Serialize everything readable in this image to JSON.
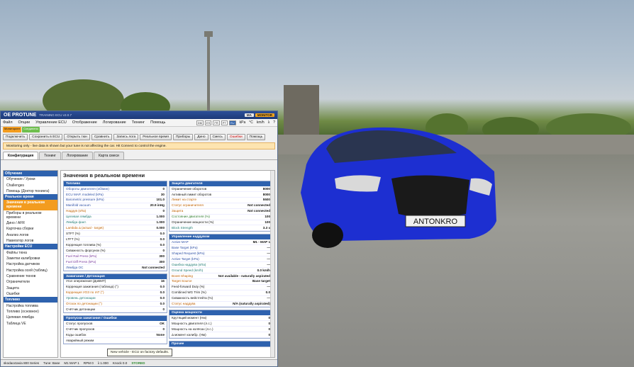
{
  "app": {
    "title": "OE PROTUNE",
    "subtitle": "TRAINING ECU  v3.0.7",
    "badge_ma": "MA",
    "badge_monitor": "MONITOR"
  },
  "menu": [
    "Файл",
    "Опции",
    "Управление ECU",
    "Отображение",
    "Логирование",
    "Тюнинг",
    "Помощь"
  ],
  "units": {
    "boxes": [
      "DM",
      "ES",
      "FR",
      "PT",
      "RU"
    ],
    "labels": [
      "kPa",
      "°C",
      "km/h",
      "λ",
      "?"
    ]
  },
  "modes": {
    "first": "Мониторинг",
    "second": "Соединено"
  },
  "toolbar": [
    "Подключить",
    "Сохранить в ECU",
    "Открыть тюн",
    "Сравнить",
    "Запись лога",
    "Реальное время",
    "Приборы",
    "Дино",
    "Смесь",
    "Ошибки",
    "Помощь"
  ],
  "warning": "Monitoring only - live data is shown but your tune is not affecting the car. Hit Connect to control the engine.",
  "tabs": [
    "Конфигурация",
    "Тюнинг",
    "Логирование",
    "Карта смеси"
  ],
  "sidebar": [
    {
      "type": "head",
      "text": "Обучение"
    },
    {
      "type": "item",
      "text": "Обучение / Уроки"
    },
    {
      "type": "item",
      "text": "Challenges"
    },
    {
      "type": "item",
      "text": "Помощь (Доктор тюнинга)"
    },
    {
      "type": "head",
      "text": "Реальное время"
    },
    {
      "type": "item",
      "text": "Значения в реальном времени",
      "active": true
    },
    {
      "type": "item",
      "text": "Приборы в реальном времени"
    },
    {
      "type": "item",
      "text": "Дино / AFR"
    },
    {
      "type": "item",
      "text": "Карточка сборки"
    },
    {
      "type": "item",
      "text": "Анализ логов"
    },
    {
      "type": "item",
      "text": "Навигатор логов"
    },
    {
      "type": "head",
      "text": "Настройки ECU"
    },
    {
      "type": "item",
      "text": "Файлы тюна"
    },
    {
      "type": "item",
      "text": "Заметки калибровки"
    },
    {
      "type": "item",
      "text": "Настройка датчиков"
    },
    {
      "type": "item",
      "text": "Настройка осей (таблиц)"
    },
    {
      "type": "item",
      "text": "Сравнение тюнов"
    },
    {
      "type": "item",
      "text": "Ограничители"
    },
    {
      "type": "item",
      "text": "Защита"
    },
    {
      "type": "item",
      "text": "Ошибки"
    },
    {
      "type": "head",
      "text": "Топливо"
    },
    {
      "type": "item",
      "text": "Настройка топлива"
    },
    {
      "type": "item",
      "text": "Топливо (основное)"
    },
    {
      "type": "item",
      "text": "Целевая лямбда"
    },
    {
      "type": "item",
      "text": "Таблица VE"
    }
  ],
  "main_title": "Значения в реальном времени",
  "left_panels": [
    {
      "title": "Топливо",
      "rows": [
        {
          "l": "Обороты двигателя (об/мин)",
          "v": "0",
          "c": "blue"
        },
        {
          "l": "ECU MAP, modeled (kPa)",
          "v": "30",
          "c": "blue"
        },
        {
          "l": "Barometric pressure (kPa)",
          "v": "101.0",
          "c": "blue"
        },
        {
          "l": "Manifold vacuum",
          "v": "20.9 inHg",
          "c": "blue"
        },
        {
          "l": "Наддув (кПа)",
          "v": "0",
          "c": "orange"
        },
        {
          "l": "Целевая лямбда",
          "v": "1.000",
          "c": "teal"
        },
        {
          "l": "Лямбда факт.",
          "v": "1.000",
          "c": "teal"
        },
        {
          "l": "Lambda Δ (actual - target)",
          "v": "0.000",
          "c": "orange"
        },
        {
          "l": "STFT (%)",
          "v": "0.0",
          "c": ""
        },
        {
          "l": "LTFT (%)",
          "v": "0.0",
          "c": ""
        },
        {
          "l": "Коррекция топлива (%)",
          "v": "0.0",
          "c": ""
        },
        {
          "l": "Скважность форсунок (%)",
          "v": "0",
          "c": ""
        },
        {
          "l": "Fuel Rail Press (kPa)",
          "v": "300",
          "c": "purple"
        },
        {
          "l": "Fuel Diff Press (kPa)",
          "v": "300",
          "c": "purple"
        },
        {
          "l": "Лямбда ОС",
          "v": "Not connected",
          "c": "blue"
        }
      ]
    },
    {
      "title": "Зажигание / Детонация",
      "rows": [
        {
          "l": "Угол опережения (ДоВМТ)",
          "v": "16",
          "c": ""
        },
        {
          "l": "Коррекция зажигания (таблица) (°)",
          "v": "0.0",
          "c": ""
        },
        {
          "l": "Коррекция УОЗ по IAT (°)",
          "v": "0.0",
          "c": "orange"
        },
        {
          "l": "Уровень детонации",
          "v": "0.0",
          "c": "teal"
        },
        {
          "l": "Отскок по детонации (°)",
          "v": "0.0",
          "c": "orange"
        },
        {
          "l": "Счётчик детонации",
          "v": "0",
          "c": ""
        }
      ]
    },
    {
      "title": "Пропуски зажигания / Ошибки",
      "rows": [
        {
          "l": "Статус пропусков",
          "v": "OK",
          "c": ""
        },
        {
          "l": "Счётчик пропусков",
          "v": "0",
          "c": ""
        },
        {
          "l": "Коды ошибок",
          "v": "None",
          "c": ""
        },
        {
          "l": "Аварийный режим",
          "v": "",
          "c": ""
        }
      ]
    }
  ],
  "right_panels": [
    {
      "title": "Защита двигателя",
      "rows": [
        {
          "l": "Ограничение оборотов",
          "v": "8000",
          "c": ""
        },
        {
          "l": "Активный лимит оборотов",
          "v": "8000",
          "c": ""
        },
        {
          "l": "Лимит на старте",
          "v": "5500",
          "c": "orange"
        },
        {
          "l": "Статус ограничителя",
          "v": "Not connected",
          "c": "orange"
        },
        {
          "l": "Защита",
          "v": "Not connected",
          "c": "orange"
        },
        {
          "l": "Состояние двигателя (%)",
          "v": "100",
          "c": "green"
        },
        {
          "l": "Ограничение мощности (%)",
          "v": "100",
          "c": ""
        },
        {
          "l": "Block Strength",
          "v": "3.3 x",
          "c": "teal"
        }
      ]
    },
    {
      "title": "Управление наддувом",
      "rows": [
        {
          "l": "Active MAP",
          "v": "M1 - MAP 1",
          "c": "blue"
        },
        {
          "l": "Base Target (kPa)",
          "v": "—",
          "c": "blue"
        },
        {
          "l": "Shaped Request (kPa)",
          "v": "—",
          "c": "blue"
        },
        {
          "l": "Active Target (kPa)",
          "v": "—",
          "c": "blue"
        },
        {
          "l": "Ошибка наддува (кПа)",
          "v": "—",
          "c": "teal"
        },
        {
          "l": "Ground Speed (km/h)",
          "v": "0.0 km/h",
          "c": "teal"
        },
        {
          "l": "Boost Shaping",
          "v": "Not available - naturally aspirated",
          "c": "orange"
        },
        {
          "l": "Target Source",
          "v": "Base target",
          "c": "orange"
        },
        {
          "l": "Feed-forward Duty (%)",
          "v": "—",
          "c": ""
        },
        {
          "l": "Combined WG Trim (%)",
          "v": "0.0",
          "c": ""
        },
        {
          "l": "Скважность вейстгейта (%)",
          "v": "—",
          "c": ""
        },
        {
          "l": "Статус наддува",
          "v": "N/A (naturally aspirated)",
          "c": "orange"
        }
      ]
    },
    {
      "title": "Оценка мощности",
      "rows": [
        {
          "l": "Крутящий момент (Нм)",
          "v": "0",
          "c": ""
        },
        {
          "l": "Мощность двигателя (л.с.)",
          "v": "0",
          "c": ""
        },
        {
          "l": "Мощность на колёсах (л.с.)",
          "v": "0",
          "c": ""
        },
        {
          "l": "Δ момент калибр. (Нм)",
          "v": "0",
          "c": ""
        }
      ]
    },
    {
      "title": "Прочее",
      "rows": []
    }
  ],
  "tooltip": "New vehicle - ECU on factory defaults.",
  "status": [
    "skodaoctavia 800 Series",
    "Tune: Base",
    "M1 MAP 1",
    "RPM 0",
    "λ 1.000",
    "Knock 0.0",
    "STORED"
  ],
  "license_plate": "ANTONKRO",
  "colors": {
    "accent": "#2e62ae",
    "active": "#f39c1f",
    "car": "#1d2fd1"
  }
}
